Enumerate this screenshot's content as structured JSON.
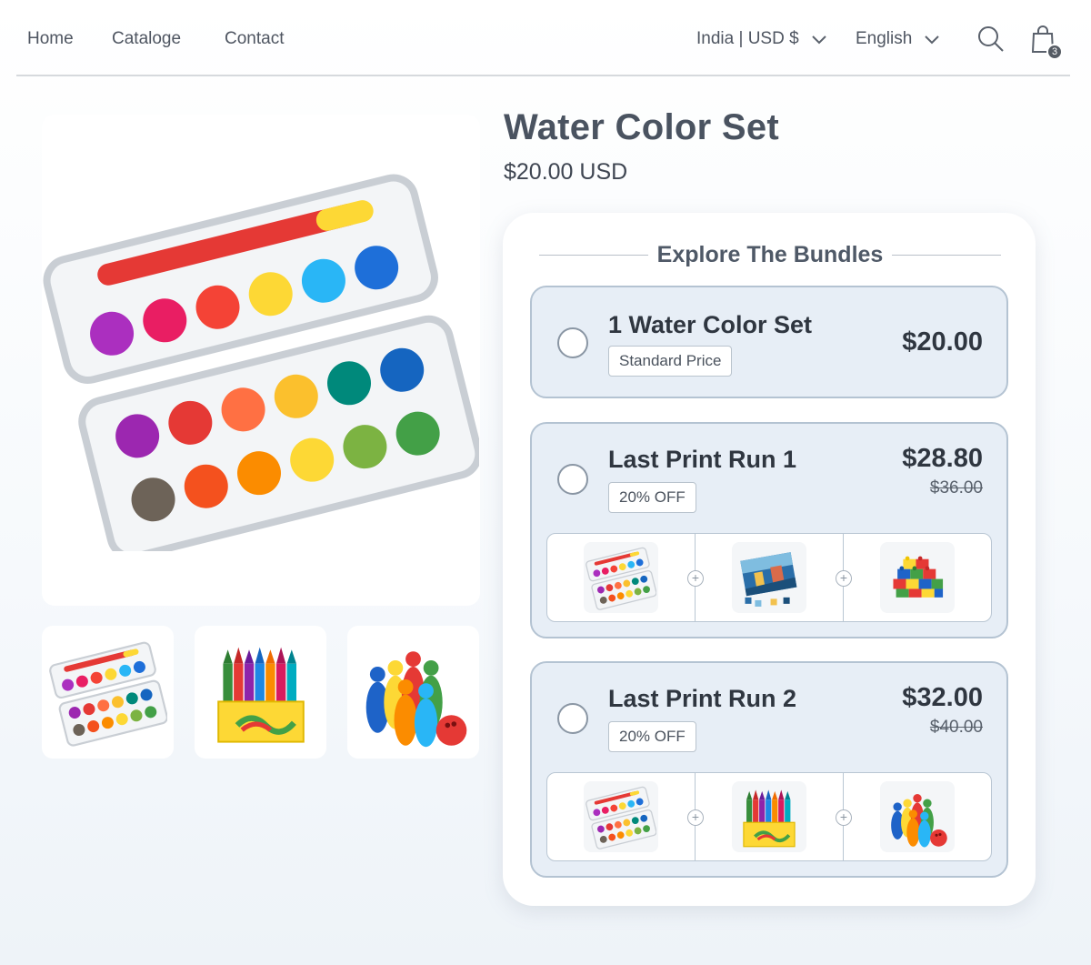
{
  "nav": {
    "links": [
      "Home",
      "Cataloge",
      "Contact"
    ],
    "currency": "India | USD $",
    "language": "English",
    "cart_count": "3",
    "icons": [
      "search-icon",
      "shopping-bag-icon",
      "chevron-down-icon"
    ]
  },
  "product": {
    "title": "Water Color Set",
    "price": "$20.00 USD"
  },
  "gallery": {
    "main": "watercolor-set",
    "thumbnails": [
      "watercolor-set",
      "crayons-box",
      "bowling-set"
    ]
  },
  "bundles": {
    "heading": "Explore The Bundles",
    "options": [
      {
        "title": "1 Water Color Set",
        "tag": "Standard Price",
        "price": "$20.00",
        "old_price": "",
        "items": []
      },
      {
        "title": "Last Print Run 1",
        "tag": "20% OFF",
        "price": "$28.80",
        "old_price": "$36.00",
        "items": [
          "watercolor-set",
          "jigsaw-puzzle",
          "building-blocks"
        ]
      },
      {
        "title": "Last Print Run 2",
        "tag": "20% OFF",
        "price": "$32.00",
        "old_price": "$40.00",
        "items": [
          "watercolor-set",
          "crayons-box",
          "bowling-set"
        ]
      }
    ]
  },
  "colors": {
    "accent_text": "#4a5360",
    "option_bg": "#e7eef6",
    "option_border": "#b4c3d2"
  }
}
